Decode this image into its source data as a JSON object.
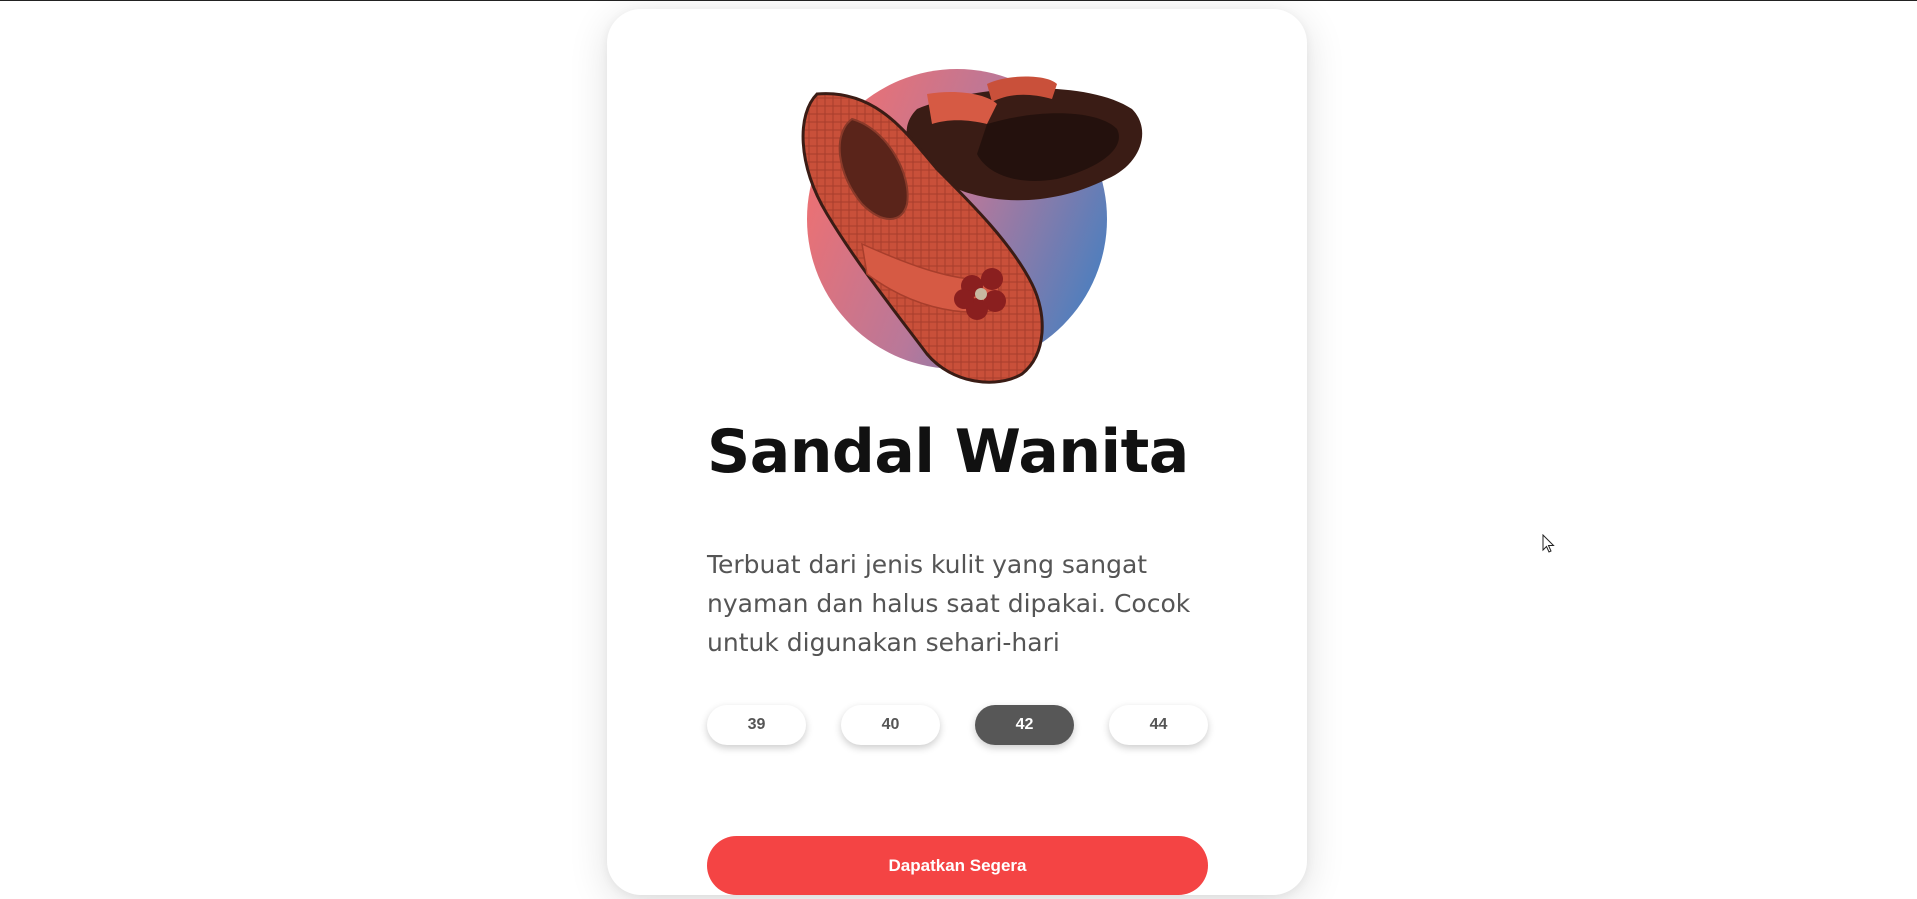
{
  "product": {
    "title": "Sandal Wanita",
    "description": "Terbuat dari jenis kulit yang sangat nyaman dan halus saat dipakai. Cocok untuk digunakan sehari-hari",
    "sizes": [
      "39",
      "40",
      "42",
      "44"
    ],
    "selected_size": "42",
    "cta_label": "Dapatkan Segera"
  },
  "colors": {
    "accent": "#f44444",
    "selected_size_bg": "#575757",
    "title_text": "#111111",
    "body_text": "#555555",
    "circle_gradient": [
      "#f07070",
      "#4a7fbf"
    ]
  },
  "icons": {
    "cursor": "mouse-pointer-icon"
  }
}
